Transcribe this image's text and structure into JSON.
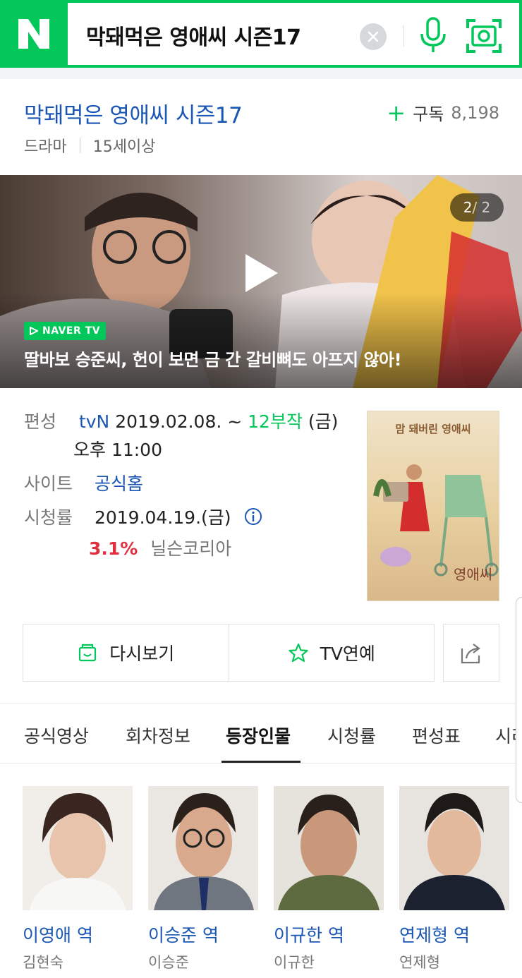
{
  "search": {
    "logo": "N",
    "query": "막돼먹은 영애씨 시즌17",
    "icons": [
      "clear-icon",
      "mic-icon",
      "lens-icon"
    ]
  },
  "program": {
    "title": "막돼먹은 영애씨 시즌17",
    "subscribe_label": "구독",
    "subscribe_count": "8,198",
    "genre": "드라마",
    "rating": "15세이상"
  },
  "video": {
    "counter_current": "2",
    "counter_total": "/ 2",
    "badge": "NAVER TV",
    "caption": "딸바보 승준씨, 헌이 보면 금 간 갈비뼈도 아프지 않아!"
  },
  "info": {
    "schedule_label": "편성",
    "channel": "tvN",
    "date_range": " 2019.02.08. ~ ",
    "episodes": "12부작",
    "day": " (금)",
    "time": "오후 11:00",
    "site_label": "사이트",
    "site_link": "공식홈",
    "ratings_label": "시청률",
    "ratings_date": "2019.04.19.(금)",
    "ratings_value": "3.1%",
    "ratings_source": "닐슨코리아",
    "poster_text": "맘 돼버린 영애씨"
  },
  "actions": {
    "replay": "다시보기",
    "tv_ent": "TV연예"
  },
  "tabs": [
    "공식영상",
    "회차정보",
    "등장인물",
    "시청률",
    "편성표",
    "시리즈"
  ],
  "active_tab": "등장인물",
  "cast": [
    {
      "role": "이영애 역",
      "actor": "김현숙"
    },
    {
      "role": "이승준 역",
      "actor": "이승준"
    },
    {
      "role": "이규한 역",
      "actor": "이규한"
    },
    {
      "role": "연제형 역",
      "actor": "연제형"
    }
  ],
  "colors": {
    "brand_green": "#03c75a",
    "link_blue": "#1a56b4",
    "rating_red": "#e03040"
  }
}
